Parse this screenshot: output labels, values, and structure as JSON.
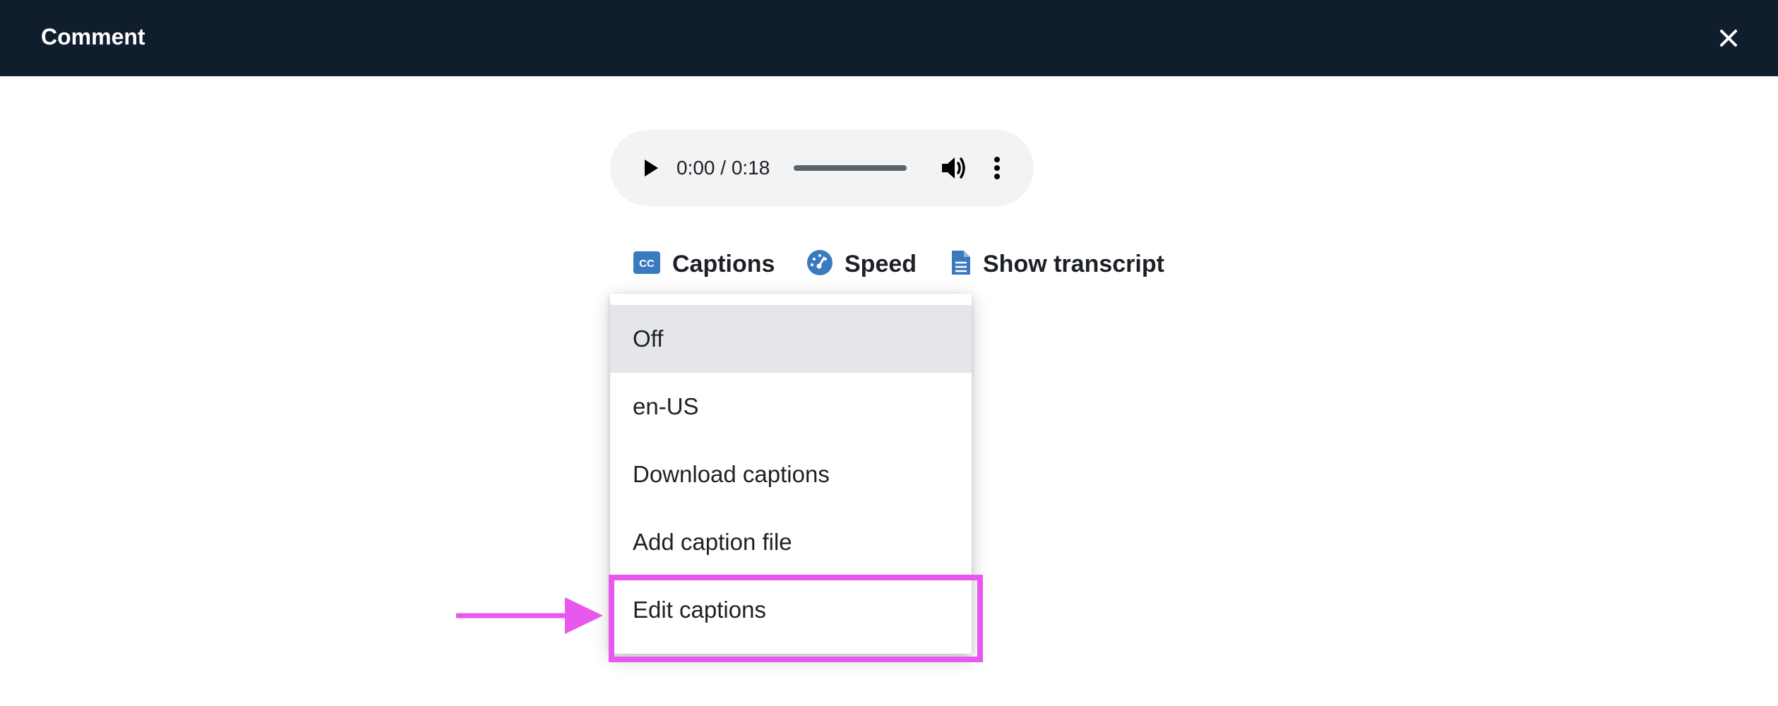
{
  "header": {
    "title": "Comment",
    "close_icon": "close-icon"
  },
  "audio_player": {
    "time": "0:00 / 0:18",
    "progress": 0,
    "play_icon": "play-icon",
    "volume_icon": "volume-icon",
    "more_icon": "more-vertical-icon"
  },
  "controls": {
    "captions_label": "Captions",
    "captions_icon": "closed-captions-icon",
    "speed_label": "Speed",
    "speed_icon": "speedometer-icon",
    "transcript_label": "Show transcript",
    "transcript_icon": "document-icon",
    "icon_color": "#3a7bbf"
  },
  "captions_menu": {
    "selected": "Off",
    "items": [
      {
        "label": "Off"
      },
      {
        "label": "en-US"
      },
      {
        "label": "Download captions"
      },
      {
        "label": "Add caption file"
      },
      {
        "label": "Edit captions"
      }
    ]
  },
  "annotation": {
    "target": "Edit captions",
    "color": "#e958ee"
  }
}
